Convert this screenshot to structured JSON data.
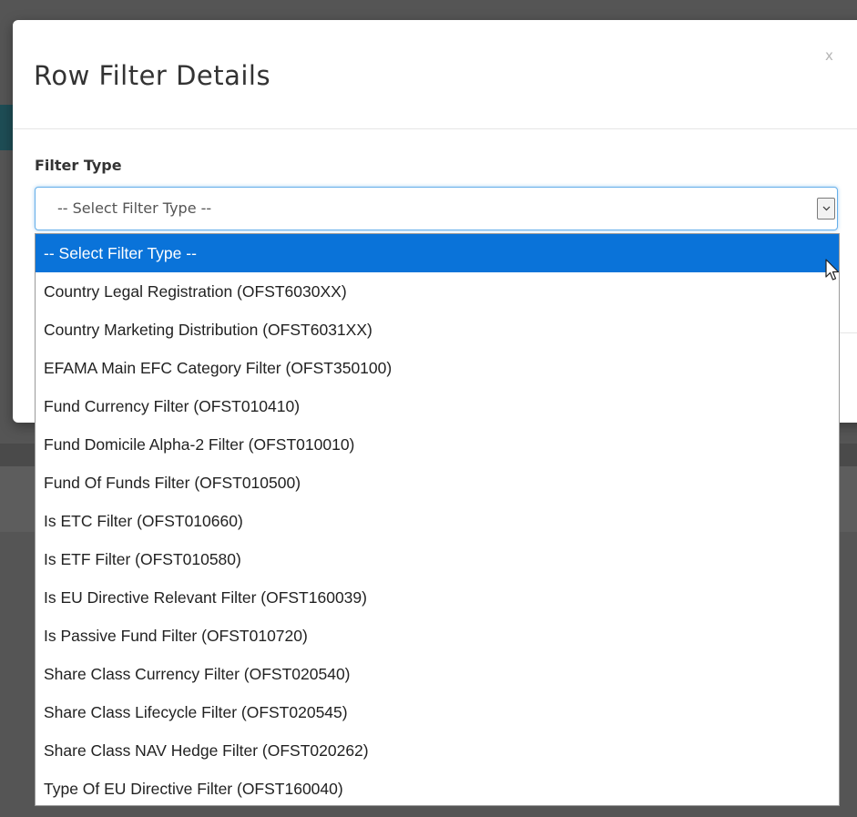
{
  "modal": {
    "title": "Row Filter Details",
    "close_label": "x"
  },
  "filter_type": {
    "label": "Filter Type",
    "selected_value": "-- Select Filter Type --",
    "options": [
      "-- Select Filter Type --",
      "Country Legal Registration (OFST6030XX)",
      "Country Marketing Distribution (OFST6031XX)",
      "EFAMA Main EFC Category Filter (OFST350100)",
      "Fund Currency Filter (OFST010410)",
      "Fund Domicile Alpha-2 Filter (OFST010010)",
      "Fund Of Funds Filter (OFST010500)",
      "Is ETC Filter (OFST010660)",
      "Is ETF Filter (OFST010580)",
      "Is EU Directive Relevant Filter (OFST160039)",
      "Is Passive Fund Filter (OFST010720)",
      "Share Class Currency Filter (OFST020540)",
      "Share Class Lifecycle Filter (OFST020545)",
      "Share Class NAV Hedge Filter (OFST020262)",
      "Type Of EU Directive Filter (OFST160040)"
    ],
    "highlighted_index": 0
  },
  "icons": {
    "close": "close-icon",
    "dropdown_arrow": "chevron-down-icon",
    "cursor": "mouse-pointer-icon"
  },
  "colors": {
    "highlight": "#0a73d9",
    "focus_border": "#66afe9",
    "title_text": "#333333"
  }
}
